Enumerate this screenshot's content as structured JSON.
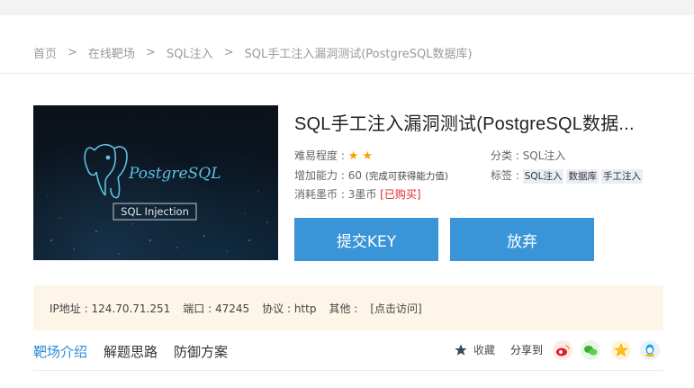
{
  "breadcrumb": {
    "items": [
      "首页",
      "在线靶场",
      "SQL注入",
      "SQL手工注入漏洞测试(PostgreSQL数据库)"
    ],
    "separator": ">"
  },
  "cover": {
    "logo_text": "PostgreSQL",
    "badge_text": "SQL Injection"
  },
  "challenge": {
    "title": "SQL手工注入漏洞测试(PostgreSQL数据...",
    "difficulty_label": "难易程度 :",
    "difficulty_stars": 2,
    "category_label": "分类 :",
    "category_value": "SQL注入",
    "ability_label": "增加能力 :",
    "ability_value": "60",
    "ability_note": "(完成可获得能力值)",
    "tags_label": "标签 :",
    "tags": [
      "SQL注入",
      "数据库",
      "手工注入"
    ],
    "cost_label": "消耗墨币 :",
    "cost_value": "3墨币",
    "bought_text": "[已购买]"
  },
  "buttons": {
    "submit_label": "提交KEY",
    "abandon_label": "放弃"
  },
  "info": {
    "ip_label": "IP地址 :",
    "ip_value": "124.70.71.251",
    "port_label": "端口 :",
    "port_value": "47245",
    "protocol_label": "协议 :",
    "protocol_value": "http",
    "other_label": "其他 :",
    "visit_link": "[点击访问]"
  },
  "tabs": [
    {
      "label": "靶场介绍",
      "active": true
    },
    {
      "label": "解题思路",
      "active": false
    },
    {
      "label": "防御方案",
      "active": false
    }
  ],
  "actions": {
    "favorite_label": "收藏",
    "share_label": "分享到"
  },
  "colors": {
    "primary": "#3a95d8",
    "star": "#f5a300",
    "bought": "#e02a2a",
    "info_bg": "#fdf6e8",
    "tab_active": "#2b8ad6"
  },
  "share_icons": [
    "weibo-icon",
    "wechat-icon",
    "qzone-icon",
    "qq-icon"
  ]
}
